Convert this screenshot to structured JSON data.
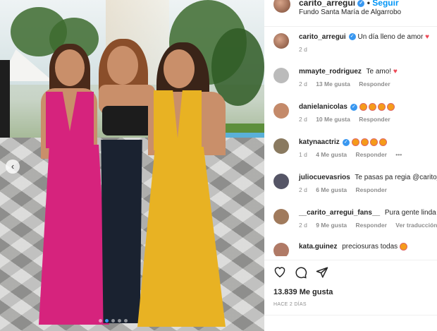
{
  "header": {
    "username": "carito_arregui",
    "follow_label": "Seguir",
    "location": "Fundo Santa María de Algarrobo"
  },
  "caption": {
    "username": "carito_arregui",
    "text": "Un día lleno de amor",
    "time": "2 d"
  },
  "comments": [
    {
      "username": "mmayte_rodriguez",
      "text": "Te amo!",
      "time": "2 d",
      "likes": "13 Me gusta",
      "reply": "Responder"
    },
    {
      "username": "danielanicolas",
      "text": "",
      "time": "2 d",
      "likes": "10 Me gusta",
      "reply": "Responder"
    },
    {
      "username": "katynaactriz",
      "text": "",
      "time": "1 d",
      "likes": "4 Me gusta",
      "reply": "Responder"
    },
    {
      "username": "juliocuevasrios",
      "text": "Te pasas pa regia @carito_",
      "time": "2 d",
      "likes": "6 Me gusta",
      "reply": "Responder"
    },
    {
      "username": "__carito_arregui_fans__",
      "text": "Pura gente linda",
      "time": "2 d",
      "likes": "9 Me gusta",
      "reply": "Responder",
      "translate": "Ver traducción"
    },
    {
      "username": "kata.guinez",
      "text": "preciosuras todas",
      "time": "",
      "likes": "",
      "reply": ""
    }
  ],
  "post": {
    "likes": "13.839 Me gusta",
    "date": "HACE 2 DÍAS"
  },
  "icons": {
    "like": "heart-icon",
    "comment": "comment-icon",
    "share": "share-icon",
    "verified": "verified-badge-icon",
    "more": "more-options-icon",
    "carousel_prev": "chevron-left-icon"
  },
  "colors": {
    "accent": "#0095f6",
    "verified": "#3897f0",
    "heart": "#ed4956",
    "text": "#262626",
    "muted": "#8e8e8e"
  }
}
